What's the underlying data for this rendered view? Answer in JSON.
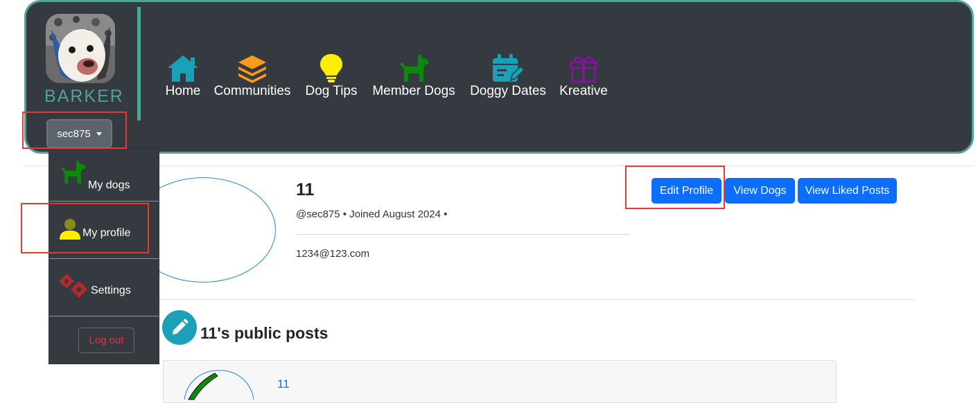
{
  "brand": {
    "name": "BARKER",
    "color": "#4fa593",
    "avatar_icon": "dog-avatar"
  },
  "user_menu": {
    "username": "sec875"
  },
  "nav": [
    {
      "label": "Home",
      "icon": "home-icon",
      "color": "#17a2b8"
    },
    {
      "label": "Communities",
      "icon": "layers-icon",
      "color": "#fd9b18"
    },
    {
      "label": "Dog Tips",
      "icon": "lightbulb-icon",
      "color": "#ffee00"
    },
    {
      "label": "Member Dogs",
      "icon": "dog-icon",
      "color": "#0a8a0a"
    },
    {
      "label": "Doggy Dates",
      "icon": "calendar-edit-icon",
      "color": "#1aa1b8"
    },
    {
      "label": "Kreative",
      "icon": "gift-icon",
      "color": "#7b1a93"
    }
  ],
  "dropdown": {
    "items": [
      {
        "label": "My dogs",
        "icon": "dog-icon",
        "color": "#0a8a0a"
      },
      {
        "label": "My profile",
        "icon": "user-icon",
        "color": "#ffee00"
      },
      {
        "label": "Settings",
        "icon": "gears-icon",
        "color": "#b22a2a"
      }
    ],
    "logout_label": "Log out"
  },
  "profile": {
    "display_name": "11",
    "meta": "@sec875 • Joined August 2024 •",
    "email": "1234@123.com"
  },
  "actions": {
    "edit_profile": "Edit Profile",
    "view_dogs": "View Dogs",
    "view_liked_posts": "View Liked Posts"
  },
  "posts": {
    "title": "11's public posts",
    "icon": "pencil-icon",
    "first_post_author": "11"
  }
}
